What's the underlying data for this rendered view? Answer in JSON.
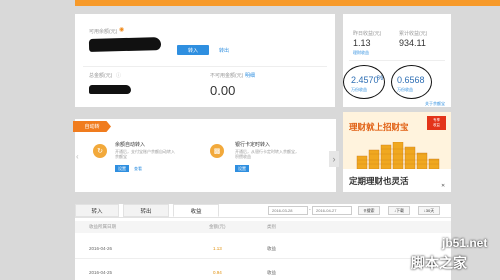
{
  "account": {
    "available_label": "可用余额(元)",
    "transfer_in": "转入",
    "transfer_out": "转出",
    "total_label": "总金额(元)",
    "unavailable_label": "不可用金额(元)",
    "detail_link": "明细",
    "unavailable_amount": "0.00"
  },
  "yield": {
    "yesterday_label": "昨日收益(元)",
    "yesterday_value": "1.13",
    "total_income_label": "累计收益(元)",
    "total_income_value": "934.11",
    "yesterday_link": "理财收益",
    "rate_value": "2.4570",
    "rate_suffix": "%",
    "rate_value_2": "0.6568",
    "rate_label": "万份收益",
    "rate_label_2": "万份收益",
    "more_link": "关于余额宝"
  },
  "auto": {
    "tag": "自动转",
    "feature1": {
      "title": "余额自动转入",
      "desc": "开通后，支付宝账户余额自动转入余额宝",
      "btn": "设置",
      "link": "查看"
    },
    "feature2": {
      "title": "银行卡定时转入",
      "desc": "开通后，从银行卡定时转入余额宝，积攒收益",
      "btn": "设置"
    }
  },
  "ad": {
    "title": "理财就上招财宝",
    "badge_line1": "专享",
    "badge_line2": "收益",
    "subtitle": "定期理财也灵活",
    "close": "关闭"
  },
  "tabs": {
    "in": "转入",
    "out": "转出",
    "income": "收益",
    "date_from": "2016-03-28",
    "date_sep": "-",
    "date_to": "2016-04-27",
    "search_btn": "搜索",
    "download_btn": "下载",
    "days_btn": "30天"
  },
  "table": {
    "headers": [
      "收益所属日期",
      "金额(元)",
      "类别"
    ],
    "rows": [
      {
        "date": "2016-04-26",
        "amount": "1.13",
        "type": "收益"
      },
      {
        "date": "2016-04-25",
        "amount": "0.94",
        "type": "收益"
      }
    ]
  },
  "watermark": {
    "line1": "jb51.net",
    "line2": "脚本之家"
  },
  "colors": {
    "accent": "#f07c1e",
    "link": "#2f8fe0",
    "amount": "#e0900c"
  }
}
